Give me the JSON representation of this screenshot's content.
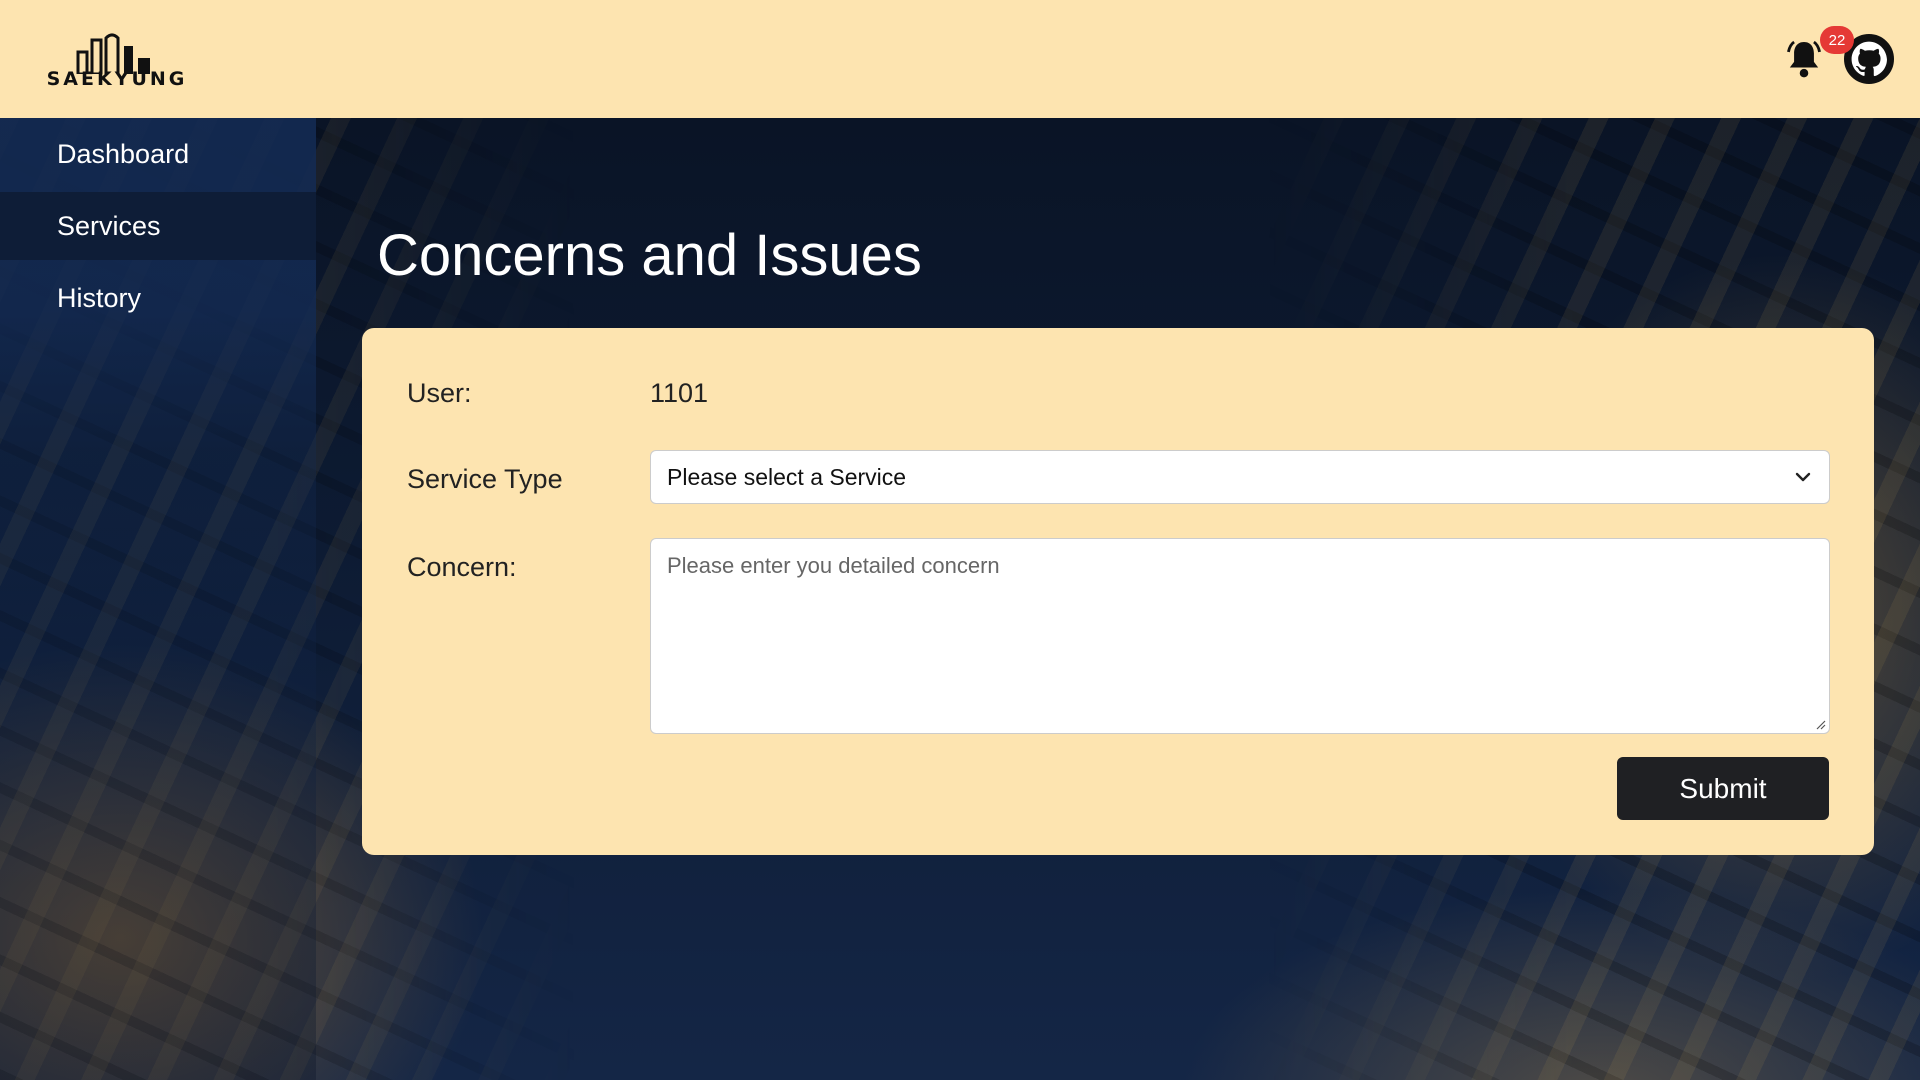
{
  "brand": {
    "name": "SAEKYUNG"
  },
  "header": {
    "notification_count": "22",
    "bell_icon": "bell-icon",
    "avatar_icon": "github-avatar-icon"
  },
  "sidebar": {
    "items": [
      {
        "label": "Dashboard",
        "active": false
      },
      {
        "label": "Services",
        "active": true
      },
      {
        "label": "History",
        "active": false
      }
    ]
  },
  "main": {
    "title": "Concerns and Issues",
    "form": {
      "user_label": "User:",
      "user_value": "1101",
      "service_type_label": "Service Type",
      "service_type_value": "Please select a Service",
      "concern_label": "Concern:",
      "concern_placeholder": "Please enter you detailed concern",
      "submit_label": "Submit"
    }
  },
  "colors": {
    "header_bg": "#fde4b0",
    "card_bg": "#fde4b0",
    "submit_bg": "#1f2023",
    "badge_bg": "#e53935"
  }
}
